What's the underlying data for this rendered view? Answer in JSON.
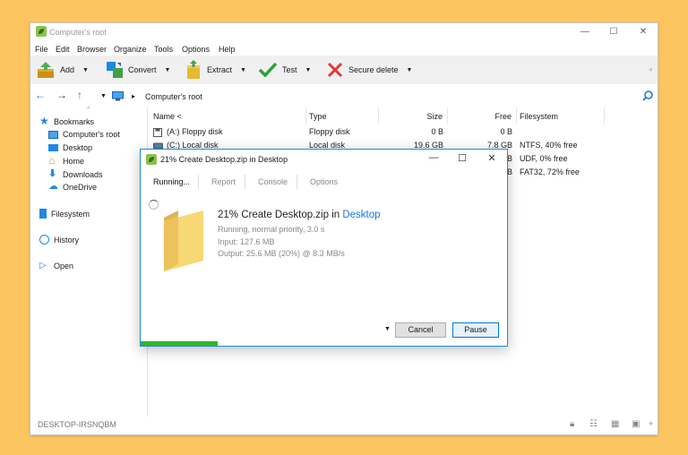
{
  "window": {
    "title": "Computer's root"
  },
  "menu": [
    "File",
    "Edit",
    "Browser",
    "Organize",
    "Tools",
    "Options",
    "Help"
  ],
  "toolbar": {
    "add_label": "Add",
    "convert_label": "Convert",
    "extract_label": "Extract",
    "test_label": "Test",
    "secure_delete_label": "Secure delete"
  },
  "address": {
    "path": "Computer's root"
  },
  "sidebar": {
    "bookmarks": "Bookmarks",
    "items": [
      "Computer's root",
      "Desktop",
      "Home",
      "Downloads",
      "OneDrive"
    ],
    "filesystem": "Filesystem",
    "history": "History",
    "open": "Open"
  },
  "columns": {
    "name": "Name <",
    "type": "Type",
    "size": "Size",
    "free": "Free",
    "filesystem": "Filesystem"
  },
  "rows": [
    {
      "name": "(A:) Floppy disk",
      "type": "Floppy disk",
      "size": "0 B",
      "free": "0 B",
      "fs": ""
    },
    {
      "name": "(C:) Local disk",
      "type": "Local disk",
      "size": "19.6 GB",
      "free": "7.8 GB",
      "fs": "NTFS, 40% free"
    },
    {
      "name": "",
      "type": "",
      "size": "",
      "free": "B",
      "fs": "UDF, 0% free"
    },
    {
      "name": "",
      "type": "",
      "size": "",
      "free": "B",
      "fs": "FAT32, 72% free"
    }
  ],
  "statusbar": {
    "computer": "DESKTOP-IRSNQBM"
  },
  "dialog": {
    "title": "21% Create Desktop.zip in Desktop",
    "tabs": [
      "Running...",
      "Report",
      "Console",
      "Options"
    ],
    "op_prefix": "21% Create Desktop.zip in ",
    "op_link": "Desktop",
    "status": "Running, normal priority, 3.0 s",
    "input": "Input: 127.6 MB",
    "output": "Output: 25.6 MB (20%) @ 8.3 MB/s",
    "cancel_label": "Cancel",
    "pause_label": "Pause",
    "progress": 0.21
  },
  "colors": {
    "accent": "#1976d2",
    "progress": "#2eb72e",
    "background": "#fdc55f"
  }
}
